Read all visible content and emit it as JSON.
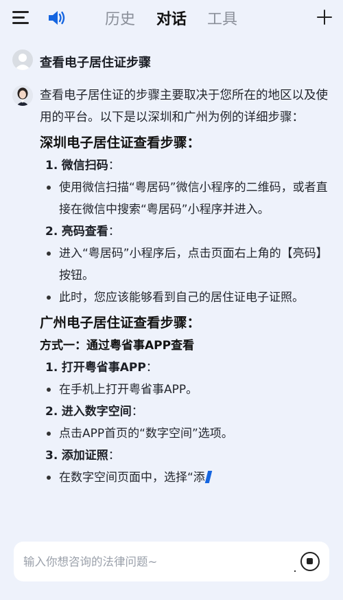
{
  "header": {
    "tabs": [
      {
        "label": "历史",
        "active": false
      },
      {
        "label": "对话",
        "active": true
      },
      {
        "label": "工具",
        "active": false
      }
    ],
    "menu_icon": "hamburger-menu-icon",
    "speaker_icon": "speaker-icon",
    "new_chat_icon": "plus-icon"
  },
  "conversation": {
    "user_message": "查看电子居住证步骤",
    "answer": {
      "intro": "查看电子居住证的步骤主要取决于您所在的地区以及使用的平台。以下是以深圳和广州为例的详细步骤：",
      "sections": [
        {
          "heading": "深圳电子居住证查看步骤：",
          "steps": [
            {
              "num": "1.",
              "title": "微信扫码",
              "suffix": "：",
              "bullets": [
                "使用微信扫描“粤居码”微信小程序的二维码，或者直接在微信中搜索“粤居码”小程序并进入。"
              ]
            },
            {
              "num": "2.",
              "title": "亮码查看",
              "suffix": "：",
              "bullets": [
                "进入“粤居码”小程序后，点击页面右上角的【亮码】按钮。",
                "此时，您应该能够看到自己的居住证电子证照。"
              ]
            }
          ]
        },
        {
          "heading": "广州电子居住证查看步骤：",
          "method": "方式一：通过粤省事APP查看",
          "steps": [
            {
              "num": "1.",
              "title": "打开粤省事APP",
              "suffix": "：",
              "bullets": [
                "在手机上打开粤省事APP。"
              ]
            },
            {
              "num": "2.",
              "title": "进入数字空间",
              "suffix": "：",
              "bullets": [
                "点击APP首页的“数字空间”选项。"
              ]
            },
            {
              "num": "3.",
              "title": "添加证照",
              "suffix": "：",
              "bullets": [
                "在数字空间页面中，选择“添"
              ]
            }
          ]
        }
      ]
    }
  },
  "input": {
    "placeholder": "输入你想咨询的法律问题~",
    "value": "",
    "stop_icon": "stop-icon"
  },
  "colors": {
    "background": "#eef2fb",
    "accent": "#1565e0",
    "text": "#1c1f26",
    "inactive_tab": "#8a8f99"
  }
}
